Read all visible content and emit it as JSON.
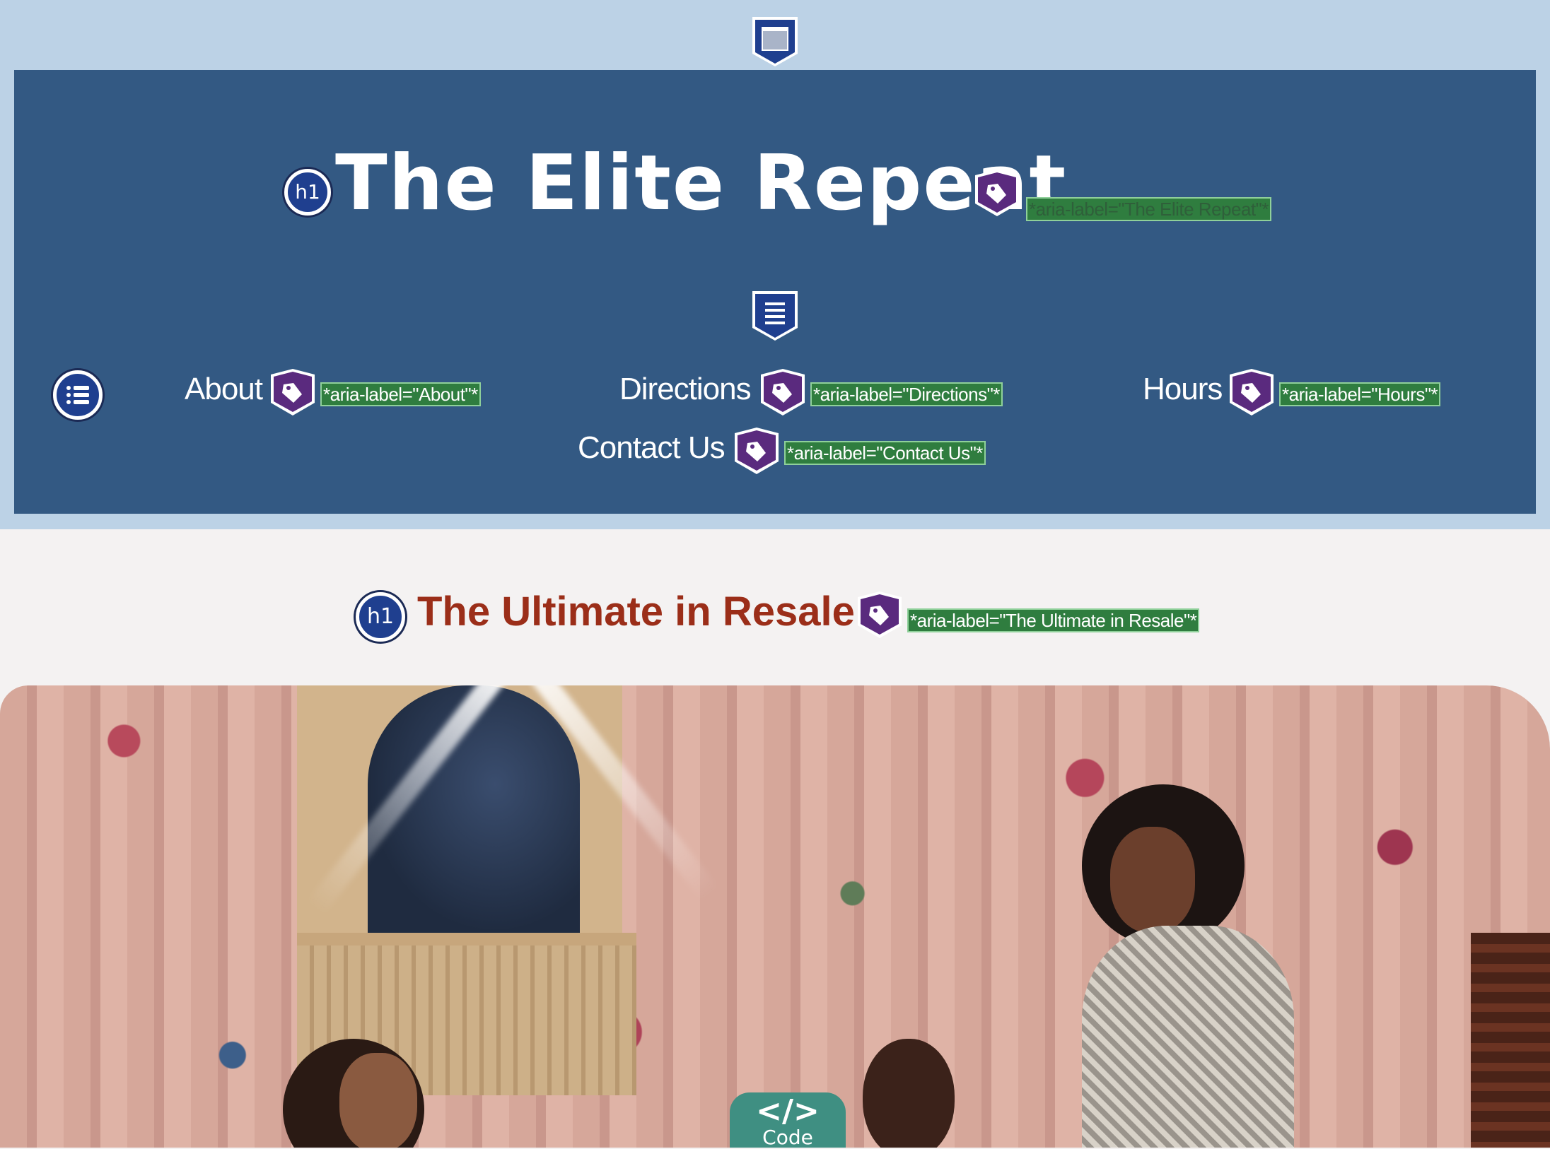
{
  "header": {
    "site_title": "The Elite Repeat",
    "site_title_aria": "*aria-label=\"The Elite Repeat\"*"
  },
  "nav": {
    "items": [
      {
        "label": "About",
        "aria": "*aria-label=\"About\"*"
      },
      {
        "label": "Directions",
        "aria": "*aria-label=\"Directions\"*"
      },
      {
        "label": "Hours",
        "aria": "*aria-label=\"Hours\"*"
      },
      {
        "label": "Contact Us",
        "aria": "*aria-label=\"Contact Us\"*"
      }
    ]
  },
  "main": {
    "heading": "The Ultimate in Resale",
    "heading_aria": "*aria-label=\"The Ultimate in Resale\"*"
  },
  "badges": {
    "h1": "h1"
  },
  "code_tab": {
    "glyph": "</>",
    "label": "Code"
  },
  "colors": {
    "top_band": "#bcd2e6",
    "header_bg": "#335983",
    "heading_color": "#9b2e19",
    "aria_label_bg": "#2f7d3f",
    "tag_purple": "#5a2a7e",
    "landmark_blue": "#1f3f8f"
  },
  "icons": {
    "banner_landmark": "banner-landmark-icon",
    "nav_landmark": "navigation-landmark-icon",
    "list": "list-icon",
    "tag": "tag-icon",
    "code": "code-icon"
  }
}
